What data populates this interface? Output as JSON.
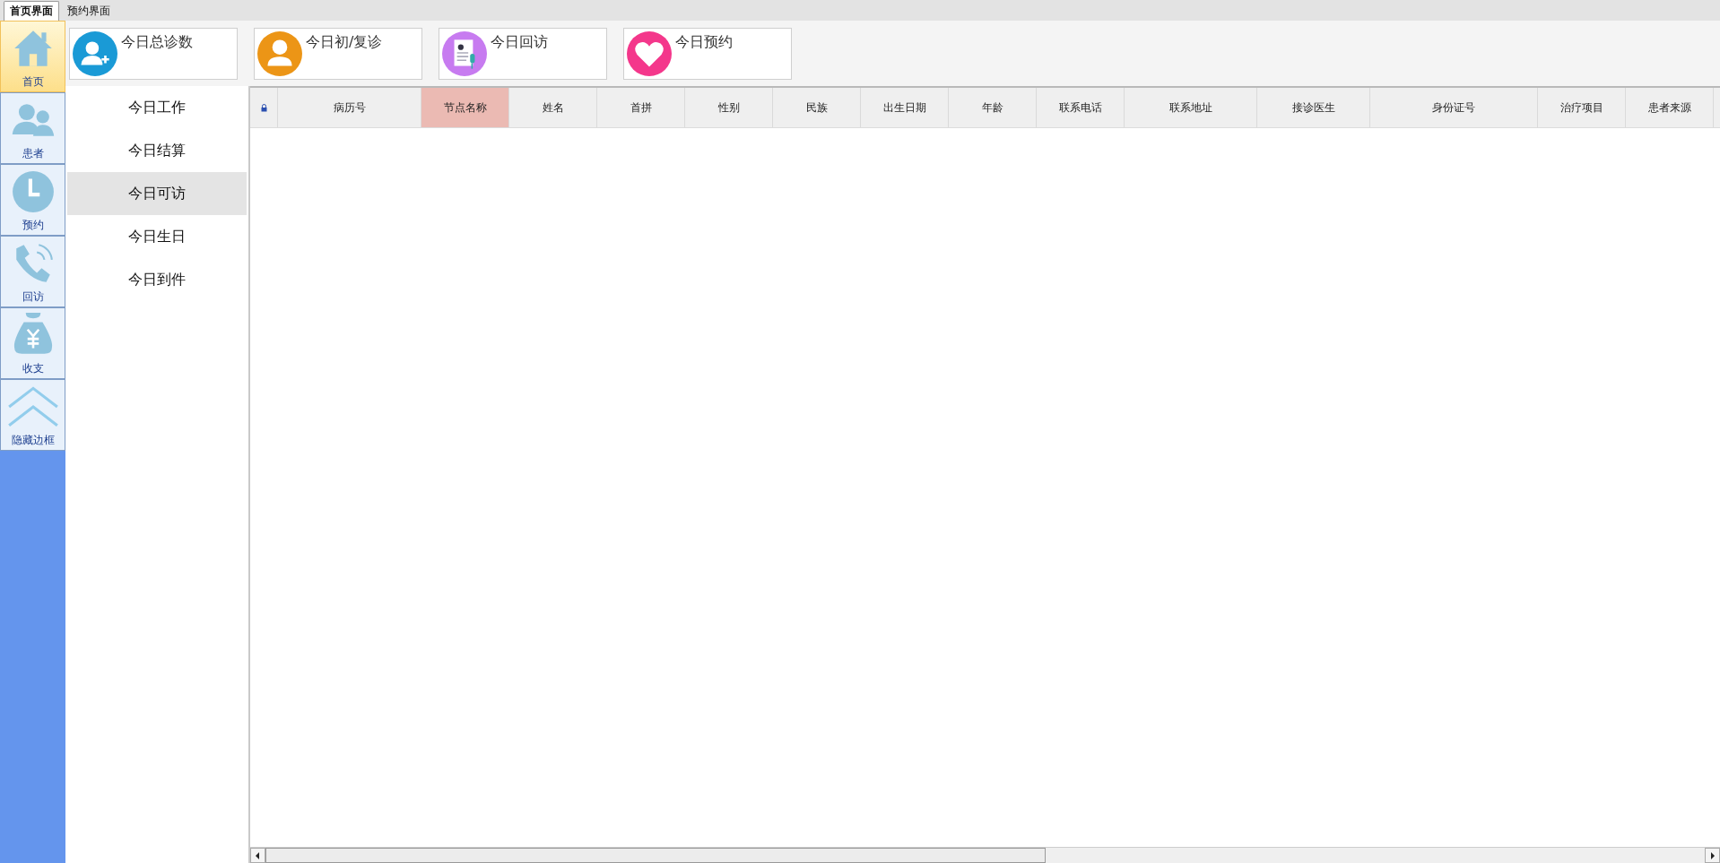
{
  "tabs": [
    {
      "label": "首页界面",
      "selected": true
    },
    {
      "label": "预约界面",
      "selected": false
    }
  ],
  "nav": [
    {
      "label": "首页",
      "kind": "home",
      "selected": true
    },
    {
      "label": "患者",
      "kind": "people",
      "selected": false
    },
    {
      "label": "预约",
      "kind": "clock",
      "selected": false
    },
    {
      "label": "回访",
      "kind": "phone",
      "selected": false
    },
    {
      "label": "收支",
      "kind": "money",
      "selected": false
    },
    {
      "label": "隐藏边框",
      "kind": "collapse",
      "selected": false
    }
  ],
  "cards": [
    {
      "label": "今日总诊数",
      "kind": "user-add",
      "color": "#1a9ad6"
    },
    {
      "label": "今日初/复诊",
      "kind": "user",
      "color": "#ec9516"
    },
    {
      "label": "今日回访",
      "kind": "document",
      "color": "#c77bf0"
    },
    {
      "label": "今日预约",
      "kind": "heart",
      "color": "#f4378b"
    }
  ],
  "submenu": [
    {
      "label": "今日工作",
      "selected": false
    },
    {
      "label": "今日结算",
      "selected": false
    },
    {
      "label": "今日可访",
      "selected": true
    },
    {
      "label": "今日生日",
      "selected": false
    },
    {
      "label": "今日到件",
      "selected": false
    }
  ],
  "table": {
    "columns": [
      {
        "label": "病历号",
        "selected": false
      },
      {
        "label": "节点名称",
        "selected": true
      },
      {
        "label": "姓名",
        "selected": false
      },
      {
        "label": "首拼",
        "selected": false
      },
      {
        "label": "性别",
        "selected": false
      },
      {
        "label": "民族",
        "selected": false
      },
      {
        "label": "出生日期",
        "selected": false
      },
      {
        "label": "年龄",
        "selected": false
      },
      {
        "label": "联系电话",
        "selected": false
      },
      {
        "label": "联系地址",
        "selected": false
      },
      {
        "label": "接诊医生",
        "selected": false
      },
      {
        "label": "身份证号",
        "selected": false
      },
      {
        "label": "治疗项目",
        "selected": false
      },
      {
        "label": "患者来源",
        "selected": false
      }
    ]
  }
}
